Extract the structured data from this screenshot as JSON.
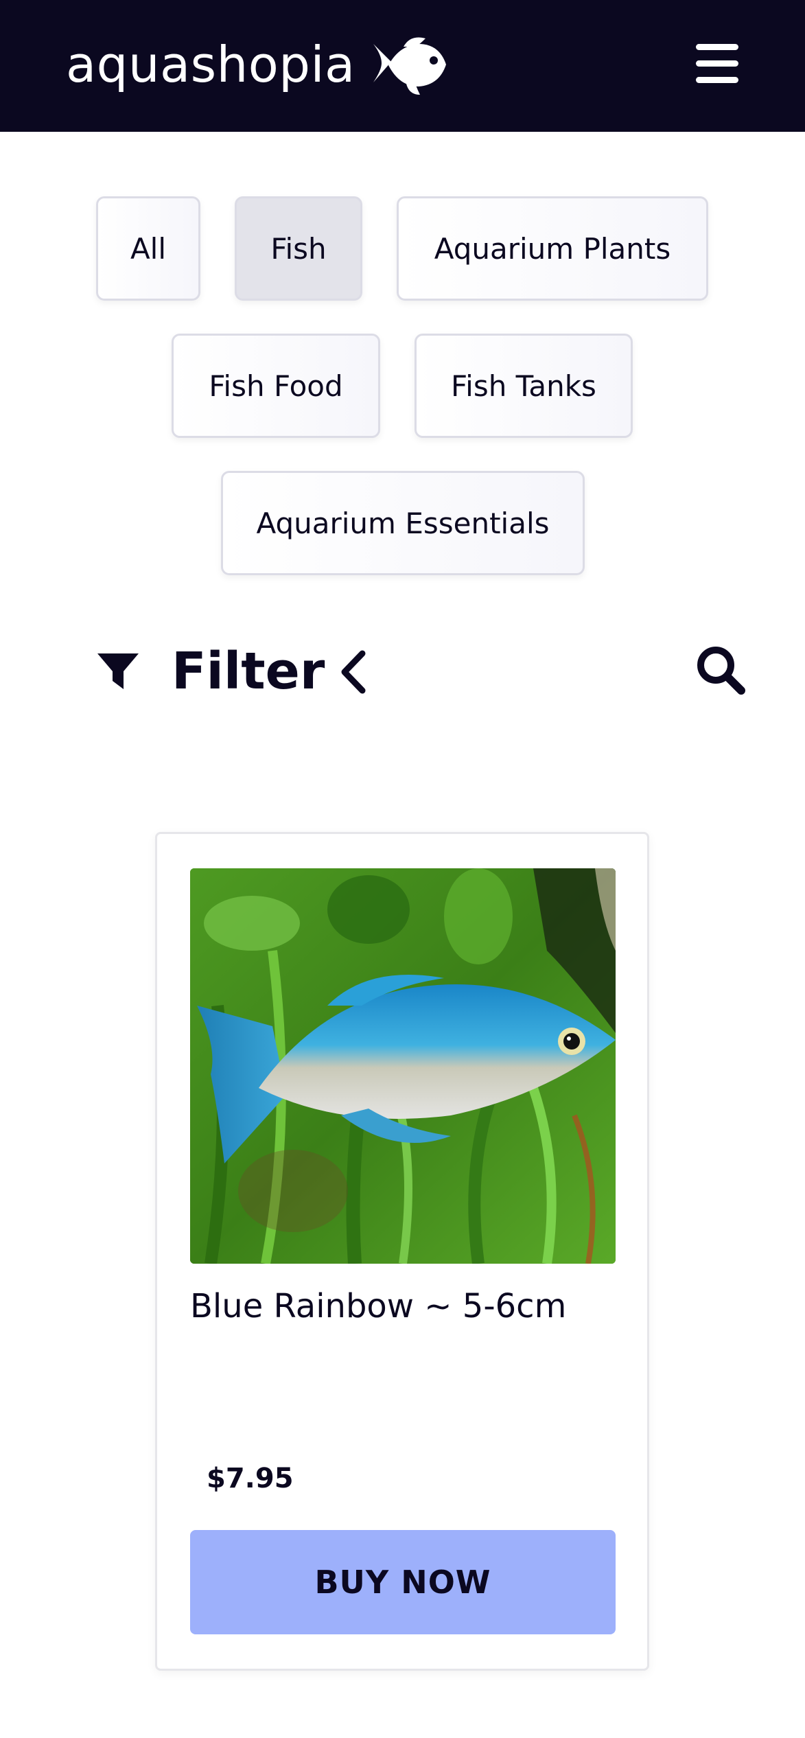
{
  "header": {
    "brand": "aquashopia",
    "logo_icon": "fish-icon",
    "menu_icon": "hamburger-menu-icon",
    "background": "#0b0820"
  },
  "categories": [
    {
      "label": "All",
      "active": false
    },
    {
      "label": "Fish",
      "active": true
    },
    {
      "label": "Aquarium Plants",
      "active": false
    },
    {
      "label": "Fish Food",
      "active": false
    },
    {
      "label": "Fish Tanks",
      "active": false
    },
    {
      "label": "Aquarium Essentials",
      "active": false
    }
  ],
  "filter": {
    "label": "Filter",
    "filter_icon": "funnel-icon",
    "toggle_icon": "chevron-left-icon",
    "search_icon": "search-icon"
  },
  "products": [
    {
      "name": "Blue Rainbow ~ 5-6cm",
      "price": "$7.95",
      "button_label": "BUY NOW",
      "button_color": "#9db0fb"
    }
  ]
}
